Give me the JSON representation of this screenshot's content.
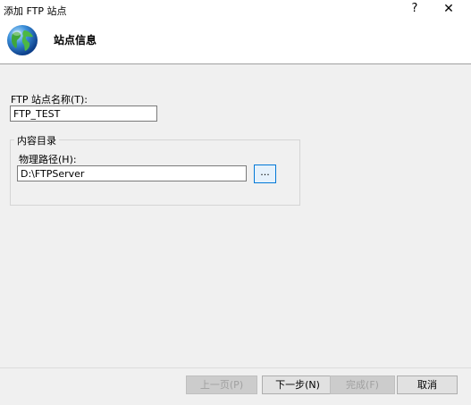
{
  "window": {
    "title": "添加 FTP 站点",
    "help_label": "?",
    "close_label": "✕"
  },
  "header": {
    "title": "站点信息",
    "icon": "globe-icon"
  },
  "site_name": {
    "label": "FTP 站点名称(T):",
    "value": "FTP_TEST"
  },
  "content_directory": {
    "group_title": "内容目录",
    "path_label": "物理路径(H):",
    "path_value": "D:\\FTPServer",
    "browse_label": "..."
  },
  "buttons": {
    "previous": "上一页(P)",
    "next": "下一步(N)",
    "finish": "完成(F)",
    "cancel": "取消"
  },
  "colors": {
    "accent": "#0078d7",
    "background": "#f0f0f0"
  }
}
